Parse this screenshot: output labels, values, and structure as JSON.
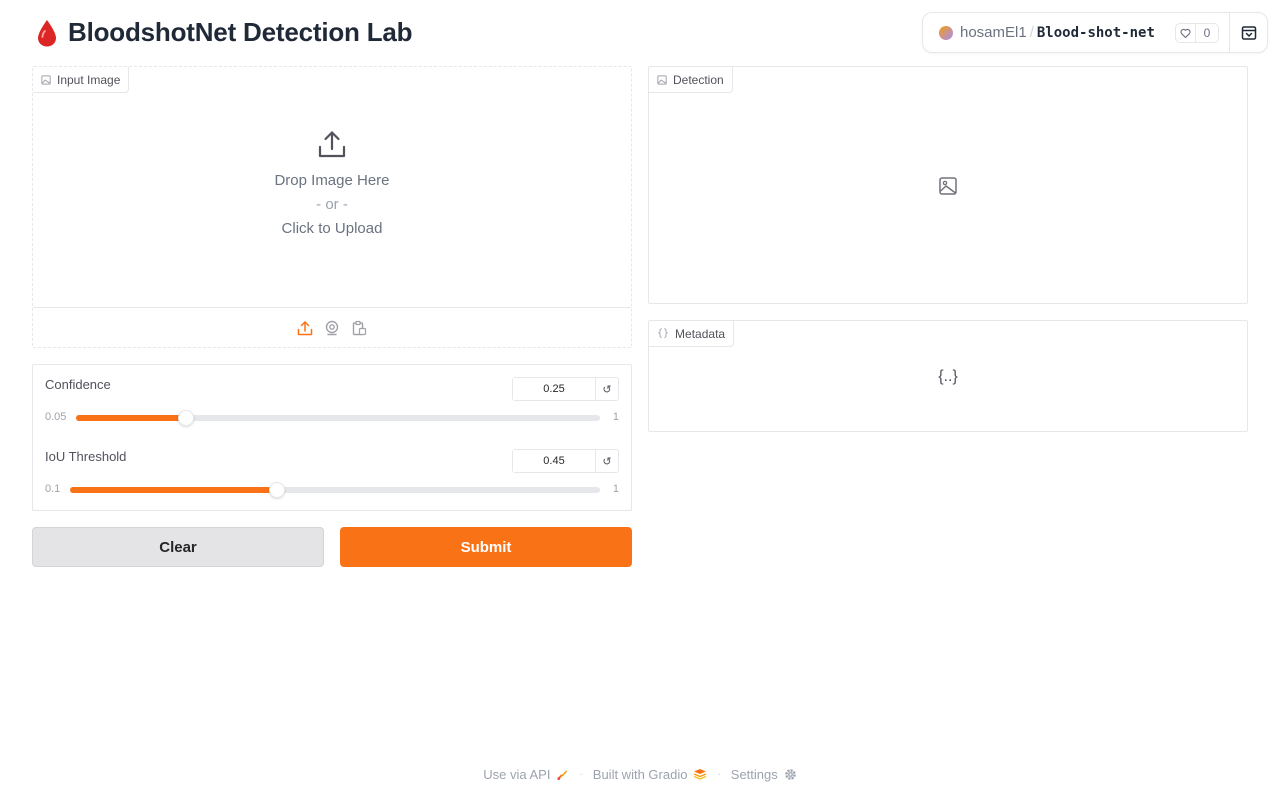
{
  "header": {
    "title": "BloodshotNet Detection Lab",
    "title_icon": "blood-drop-icon"
  },
  "space_badge": {
    "owner": "hosamEl1",
    "separator": "/",
    "repo": "Blood-shot-net",
    "likes": "0"
  },
  "input_panel": {
    "label": "Input Image",
    "drop_text": "Drop Image Here",
    "or_text": "- or -",
    "click_text": "Click to Upload",
    "sources": [
      "upload-icon",
      "webcam-icon",
      "clipboard-icon"
    ]
  },
  "detection_panel": {
    "label": "Detection"
  },
  "metadata_panel": {
    "label": "Metadata",
    "placeholder": "{..}"
  },
  "sliders": {
    "confidence": {
      "label": "Confidence",
      "value": "0.25",
      "min": "0.05",
      "max": "1",
      "fraction": 0.21
    },
    "iou": {
      "label": "IoU Threshold",
      "value": "0.45",
      "min": "0.1",
      "max": "1",
      "fraction": 0.39
    }
  },
  "buttons": {
    "clear": "Clear",
    "submit": "Submit"
  },
  "footer": {
    "api": "Use via API",
    "built": "Built with Gradio",
    "settings": "Settings",
    "separator": "·"
  },
  "colors": {
    "accent": "#f97316",
    "drop": "#dc2626"
  }
}
